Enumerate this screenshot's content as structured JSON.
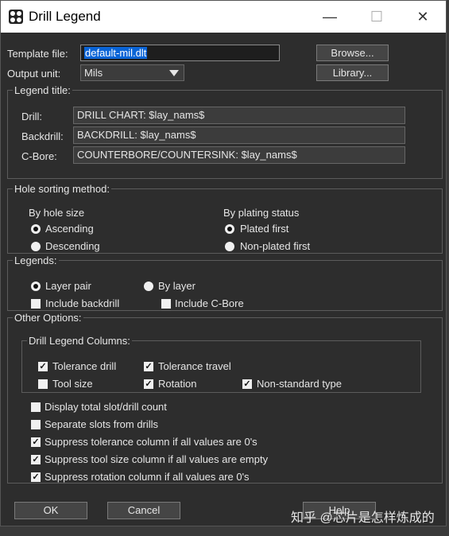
{
  "window": {
    "title": "Drill Legend",
    "minimize": "—",
    "maximize": "☐",
    "close": "✕"
  },
  "top": {
    "template_label": "Template file:",
    "template_value": "default-mil.dlt",
    "browse_button": "Browse...",
    "unit_label": "Output unit:",
    "unit_value": "Mils",
    "library_button": "Library..."
  },
  "legend_title": {
    "group_label": "Legend title:",
    "drill_label": "Drill:",
    "drill_value": "DRILL CHART: $lay_nams$",
    "backdrill_label": "Backdrill:",
    "backdrill_value": "BACKDRILL: $lay_nams$",
    "cbore_label": "C-Bore:",
    "cbore_value": "COUNTERBORE/COUNTERSINK: $lay_nams$"
  },
  "sorting": {
    "group_label": "Hole sorting method:",
    "size_label": "By hole size",
    "ascending": "Ascending",
    "descending": "Descending",
    "plating_label": "By plating status",
    "plated_first": "Plated first",
    "nonplated_first": "Non-plated first"
  },
  "legends": {
    "group_label": "Legends:",
    "layer_pair": "Layer pair",
    "by_layer": "By layer",
    "include_backdrill": "Include backdrill",
    "include_cbore": "Include C-Bore"
  },
  "other": {
    "group_label": "Other Options:",
    "columns_label": "Drill Legend Columns:",
    "tolerance_drill": "Tolerance drill",
    "tolerance_travel": "Tolerance travel",
    "tool_size": "Tool size",
    "rotation": "Rotation",
    "nonstandard_type": "Non-standard type",
    "display_total": "Display total slot/drill count",
    "separate_slots": "Separate slots from drills",
    "suppress_tolerance": "Suppress tolerance column if all values are 0's",
    "suppress_tool_size": "Suppress tool size column if all values are empty",
    "suppress_rotation": "Suppress rotation column if all values are 0's"
  },
  "footer": {
    "ok": "OK",
    "cancel": "Cancel",
    "help": "Help"
  },
  "watermark": "知乎 @芯片是怎样炼成的",
  "check_mark": "✓"
}
